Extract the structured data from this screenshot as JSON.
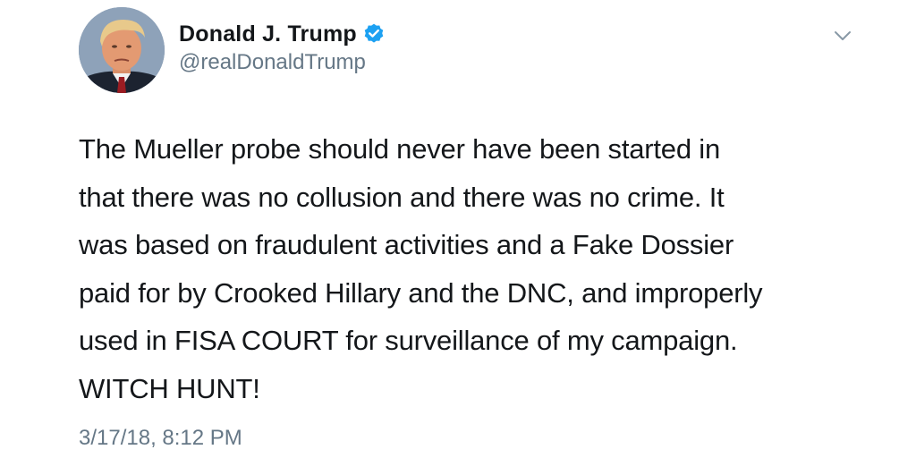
{
  "tweet": {
    "author": {
      "display_name": "Donald J. Trump",
      "handle": "@realDonaldTrump",
      "verified": true
    },
    "text": "The Mueller probe should never have been started in\nthat there was no collusion and there was no crime. It\nwas based on fraudulent activities and a Fake Dossier\npaid for by Crooked Hillary and the DNC, and improperly\nused in FISA COURT for surveillance of my campaign.\nWITCH HUNT!",
    "timestamp": "3/17/18, 8:12 PM"
  },
  "icons": {
    "verified": "verified-badge-icon",
    "menu": "chevron-down-icon"
  },
  "colors": {
    "verified_blue": "#1da1f2",
    "secondary_text": "#657786",
    "primary_text": "#14171a"
  }
}
